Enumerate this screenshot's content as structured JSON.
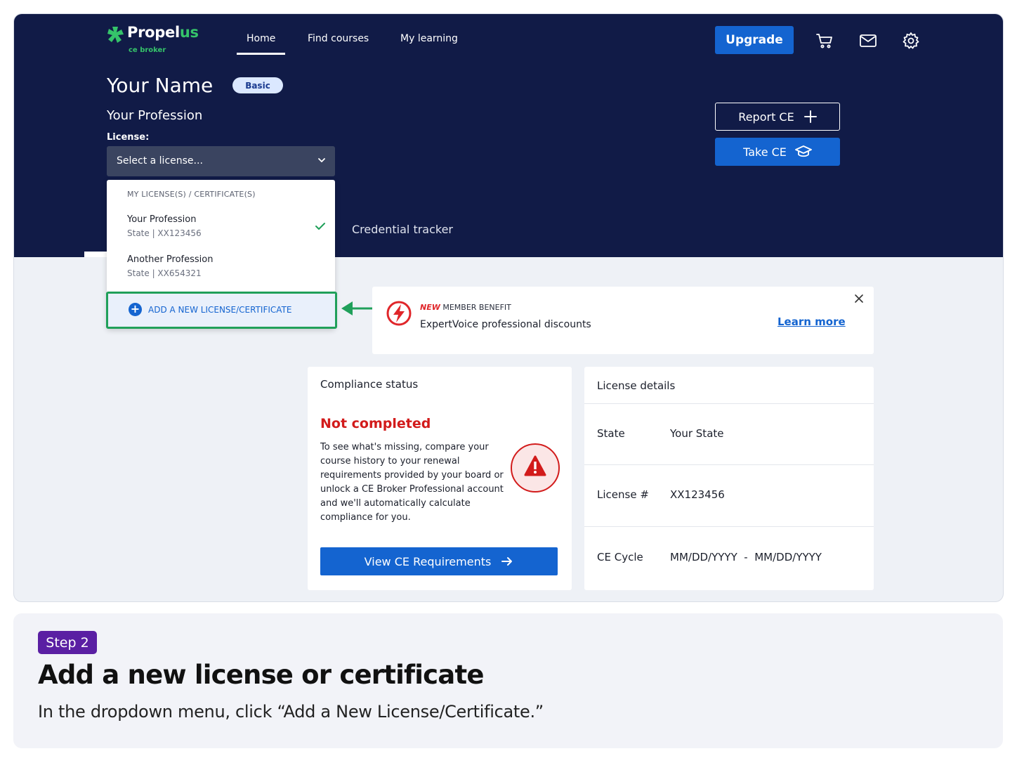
{
  "brand": {
    "name_main": "Propel",
    "name_accent": "us",
    "sub": "ce broker",
    "accent_color": "#35c46a"
  },
  "nav": {
    "home": "Home",
    "find_courses": "Find courses",
    "my_learning": "My learning"
  },
  "header_actions": {
    "upgrade": "Upgrade",
    "icons": [
      "cart-icon",
      "mail-icon",
      "gear-icon"
    ]
  },
  "profile": {
    "name": "Your Name",
    "plan_badge": "Basic",
    "profession": "Your Profession",
    "license_label": "License:"
  },
  "license_select": {
    "placeholder": "Select a license..."
  },
  "dropdown": {
    "header": "MY LICENSE(S) / CERTIFICATE(S)",
    "items": [
      {
        "title": "Your Profession",
        "subtitle": "State  |  XX123456",
        "selected": true
      },
      {
        "title": "Another Profession",
        "subtitle": "State  |  XX654321",
        "selected": false
      }
    ],
    "add_label": "ADD A NEW LICENSE/CERTIFICATE"
  },
  "hero_buttons": {
    "report_ce": "Report CE",
    "take_ce": "Take CE"
  },
  "tabs": {
    "credential_tracker": "Credential tracker"
  },
  "benefit": {
    "tag_new": "NEW",
    "tag_rest": " MEMBER BENEFIT",
    "title": "ExpertVoice professional discounts",
    "link": "Learn more"
  },
  "compliance": {
    "header": "Compliance status",
    "status": "Not completed",
    "description": "To see what's missing, compare your course history to your renewal requirements provided by your board or unlock a CE Broker Professional account and we'll automatically calculate compliance for you.",
    "button": "View CE Requirements"
  },
  "license_details": {
    "header": "License details",
    "rows": [
      {
        "label": "State",
        "value": "Your State"
      },
      {
        "label": "License #",
        "value": "XX123456"
      },
      {
        "label": "CE Cycle",
        "value": "MM/DD/YYYY  -  MM/DD/YYYY"
      }
    ]
  },
  "step": {
    "badge": "Step 2",
    "title": "Add a new license or certificate",
    "description": "In the dropdown menu, click “Add a New License/Certificate.”"
  },
  "colors": {
    "hero_bg": "#111b47",
    "primary": "#1464d0",
    "highlight_border": "#20a05a",
    "error": "#d21b1b",
    "step_badge": "#5a1fa3"
  }
}
